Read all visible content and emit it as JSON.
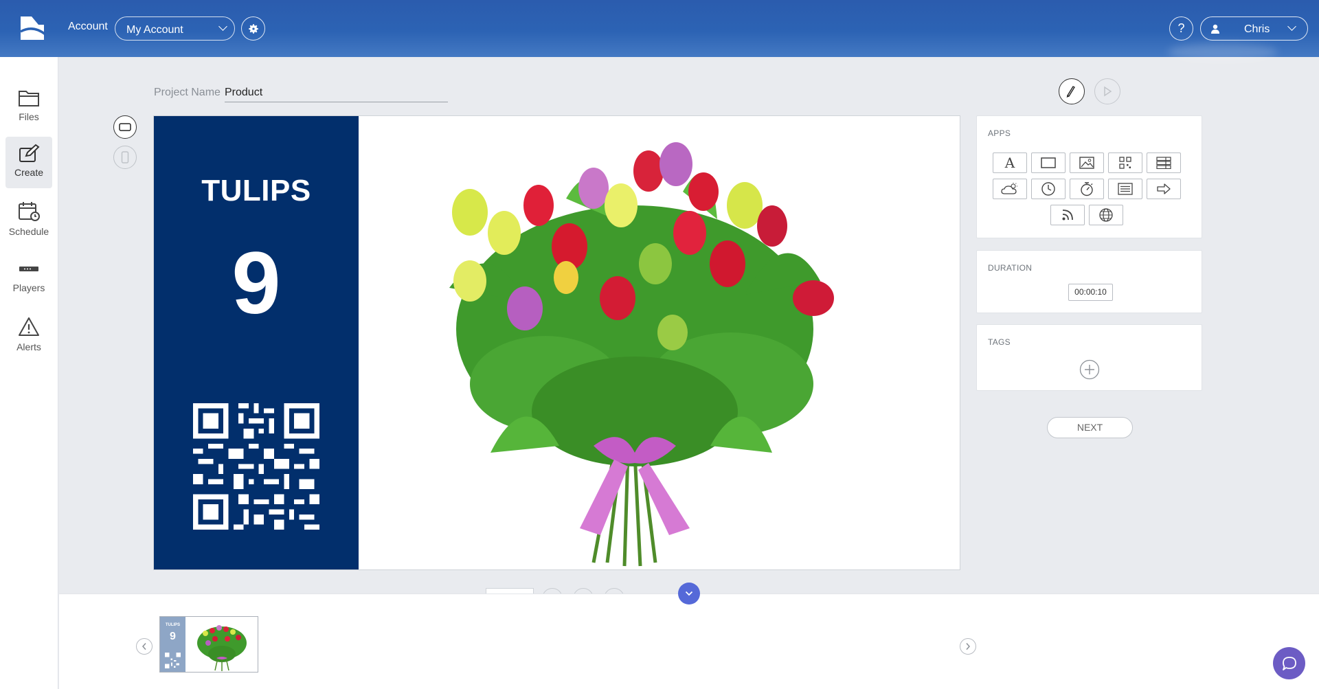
{
  "header": {
    "account_label": "Account",
    "account_select": "My Account",
    "help_label": "?",
    "user_name": "Chris",
    "colors": {
      "bar": "#2c63b4"
    }
  },
  "sidebar": {
    "items": [
      {
        "label": "Files",
        "icon": "folder-icon"
      },
      {
        "label": "Create",
        "icon": "create-icon",
        "active": true
      },
      {
        "label": "Schedule",
        "icon": "calendar-icon"
      },
      {
        "label": "Players",
        "icon": "player-icon"
      },
      {
        "label": "Alerts",
        "icon": "alert-icon"
      }
    ]
  },
  "editor": {
    "project_name_label": "Project Name",
    "project_name_value": "Product",
    "canvas": {
      "panel_title": "TULIPS",
      "panel_number": "9",
      "panel_color": "#022f6c"
    }
  },
  "right_panel": {
    "apps_title": "APPS",
    "apps": [
      "text-icon",
      "rectangle-icon",
      "image-icon",
      "qr-code-icon",
      "table-icon",
      "weather-icon",
      "clock-icon",
      "timer-icon",
      "list-icon",
      "arrow-right-icon",
      "rss-icon",
      "web-icon"
    ],
    "duration_title": "DURATION",
    "duration_value": "00:00:10",
    "tags_title": "TAGS",
    "next_label": "NEXT"
  },
  "slides_strip": {
    "thumb_title": "TULIPS",
    "thumb_number": "9"
  },
  "accent_color": "#5569d8"
}
